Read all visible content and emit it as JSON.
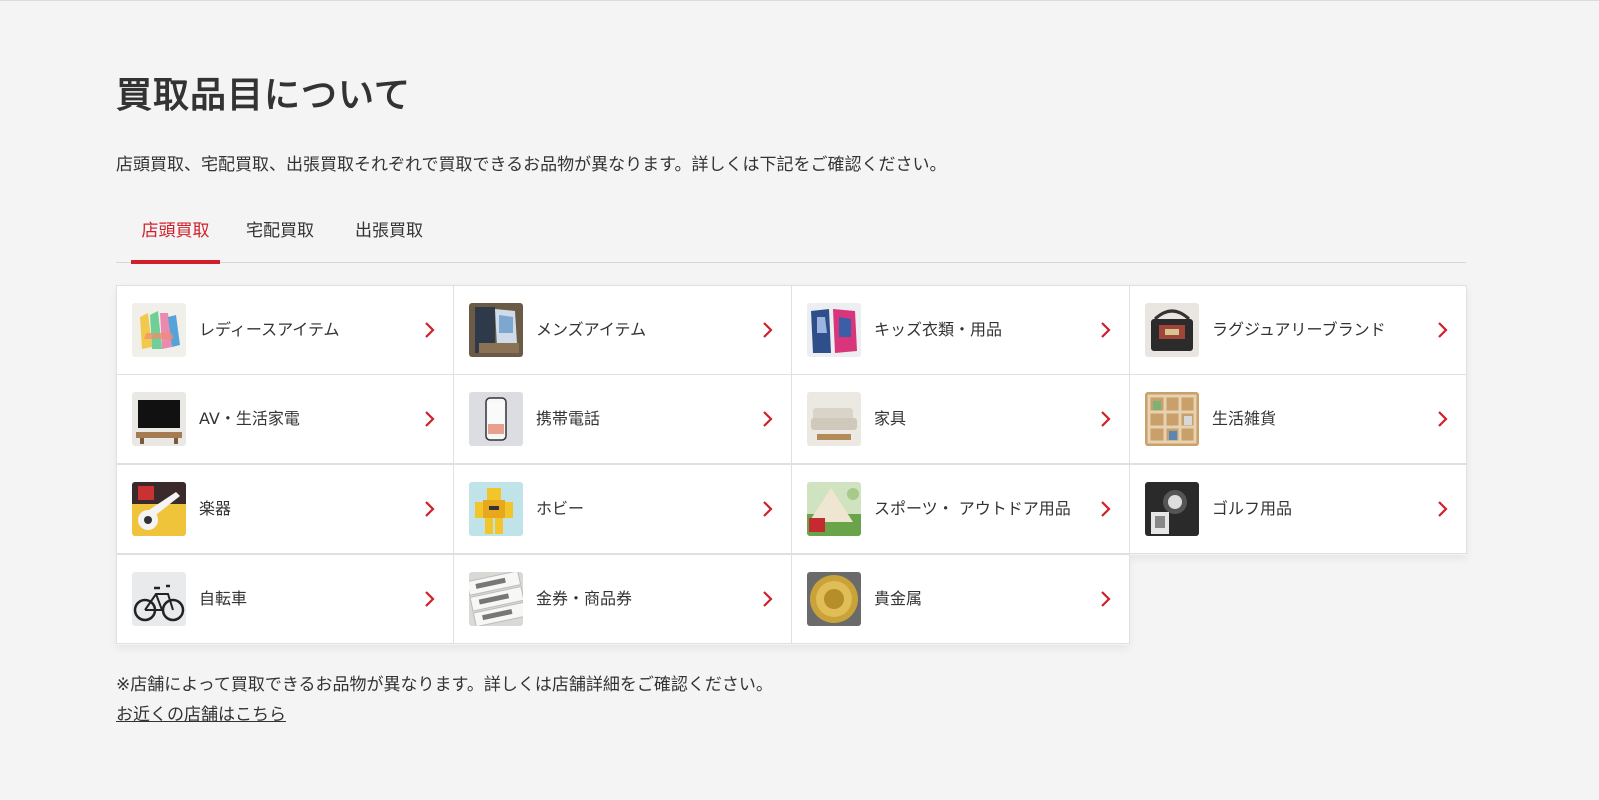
{
  "header": {
    "title": "買取品目について",
    "lead": "店頭買取、宅配買取、出張買取それぞれで買取できるお品物が異なります。詳しくは下記をご確認ください。"
  },
  "tabs": [
    {
      "label": "店頭買取",
      "active": true
    },
    {
      "label": "宅配買取",
      "active": false
    },
    {
      "label": "出張買取",
      "active": false
    }
  ],
  "items": [
    {
      "label": "レディースアイテム",
      "icon": "ladies-clothing-thumbnail"
    },
    {
      "label": "メンズアイテム",
      "icon": "mens-clothing-thumbnail"
    },
    {
      "label": "キッズ衣類・用品",
      "icon": "kids-clothing-thumbnail"
    },
    {
      "label": "ラグジュアリーブランド",
      "icon": "luxury-bag-thumbnail"
    },
    {
      "label": "AV・生活家電",
      "icon": "tv-thumbnail"
    },
    {
      "label": "携帯電話",
      "icon": "smartphone-thumbnail"
    },
    {
      "label": "家具",
      "icon": "sofa-thumbnail"
    },
    {
      "label": "生活雑貨",
      "icon": "shelf-thumbnail"
    },
    {
      "label": "楽器",
      "icon": "guitar-thumbnail"
    },
    {
      "label": "ホビー",
      "icon": "robot-figure-thumbnail"
    },
    {
      "label": "スポーツ・ アウトドア用品",
      "icon": "tent-thumbnail"
    },
    {
      "label": "ゴルフ用品",
      "icon": "golf-bag-thumbnail"
    },
    {
      "label": "自転車",
      "icon": "bicycle-thumbnail"
    },
    {
      "label": "金券・商品券",
      "icon": "gift-voucher-thumbnail"
    },
    {
      "label": "貴金属",
      "icon": "gold-coin-thumbnail"
    }
  ],
  "footer": {
    "note": "※店舗によって買取できるお品物が異なります。詳しくは店舗詳細をご確認ください。",
    "link": "お近くの店舗はこちら"
  },
  "colors": {
    "accent": "#d0202a",
    "background": "#f4f4f4",
    "text": "#333333",
    "card": "#ffffff"
  }
}
